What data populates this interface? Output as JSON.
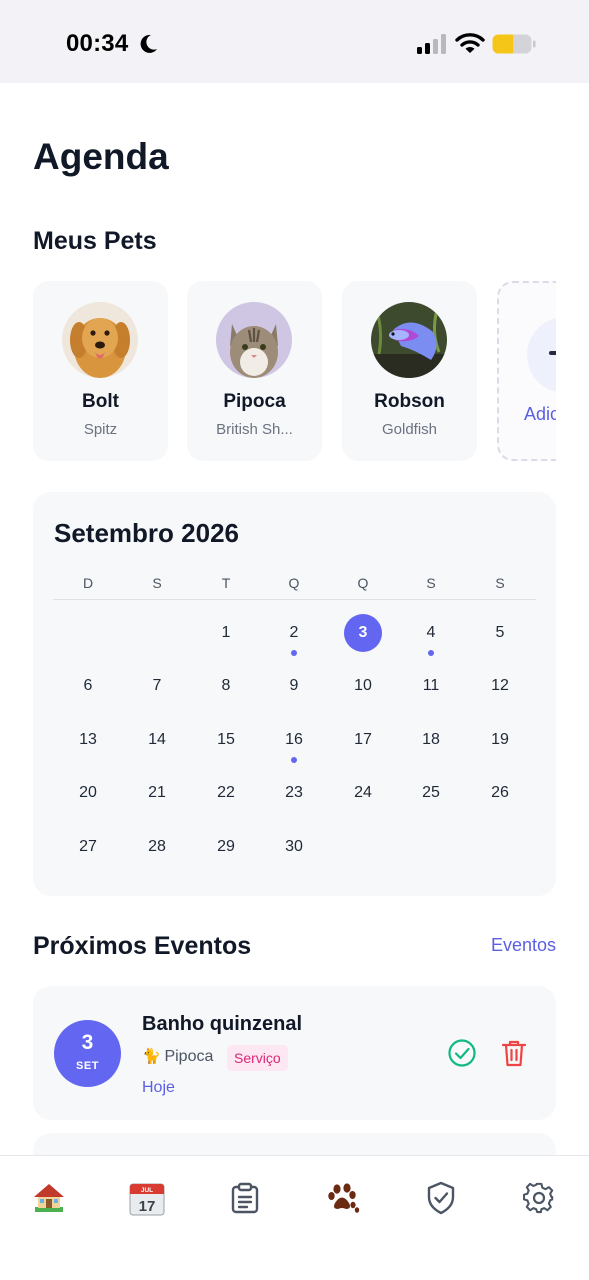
{
  "status_bar": {
    "time": "00:34"
  },
  "page": {
    "title": "Agenda"
  },
  "pets_section": {
    "title": "Meus Pets",
    "pets": [
      {
        "name": "Bolt",
        "breed": "Spitz",
        "avatar_icon": "dog-photo"
      },
      {
        "name": "Pipoca",
        "breed": "British Sh...",
        "avatar_icon": "cat-photo"
      },
      {
        "name": "Robson",
        "breed": "Goldfish",
        "avatar_icon": "betta-fish-photo"
      }
    ],
    "add_label": "Adicionar"
  },
  "calendar": {
    "title": "Setembro 2026",
    "weekdays": [
      "D",
      "S",
      "T",
      "Q",
      "Q",
      "S",
      "S"
    ],
    "first_weekday_index": 2,
    "days_in_month": 30,
    "selected_day": 3,
    "event_days": [
      2,
      4,
      16
    ],
    "accent_color": "#6366f1"
  },
  "events_section": {
    "title": "Próximos Eventos",
    "link": "Eventos",
    "events": [
      {
        "day": "3",
        "month": "SET",
        "title": "Banho quinzenal",
        "pet": "Pipoca",
        "pet_icon": "🐈",
        "tag": "Serviço",
        "when": "Hoje"
      }
    ]
  },
  "tab_bar": {
    "items": [
      {
        "icon": "home-icon"
      },
      {
        "icon": "calendar-icon",
        "text": "17",
        "month_text": "JUL"
      },
      {
        "icon": "clipboard-icon"
      },
      {
        "icon": "paw-icon"
      },
      {
        "icon": "shield-check-icon"
      },
      {
        "icon": "settings-icon"
      }
    ]
  }
}
